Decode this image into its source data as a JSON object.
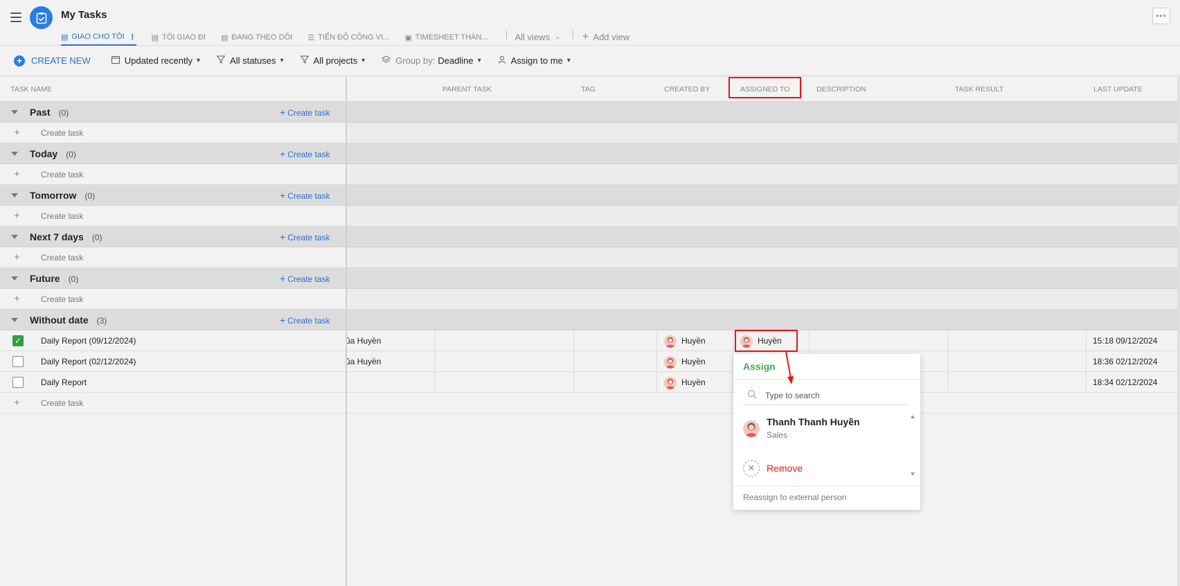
{
  "header": {
    "title": "My Tasks",
    "tabs": [
      {
        "label": "GIAO CHO TÔI",
        "active": true
      },
      {
        "label": "TÔI GIAO ĐI",
        "active": false
      },
      {
        "label": "ĐANG THEO DÕI",
        "active": false
      },
      {
        "label": "TIẾN ĐỘ CÔNG VI...",
        "active": false
      },
      {
        "label": "TIMESHEET THÀN...",
        "active": false
      }
    ],
    "all_views": "All views",
    "add_view": "Add view",
    "more": "•••"
  },
  "toolbar": {
    "create_new": "CREATE NEW",
    "sort": "Updated recently",
    "status": "All statuses",
    "projects": "All projects",
    "group_by_label": "Group by:",
    "group_by_value": "Deadline",
    "assign": "Assign to me"
  },
  "columns": {
    "task_name": "TASK NAME",
    "parent_task": "PARENT TASK",
    "tag": "TAG",
    "created_by": "CREATED BY",
    "assigned_to": "ASSIGNED TO",
    "description": "DESCRIPTION",
    "task_result": "TASK RESULT",
    "last_update": "LAST UPDATE"
  },
  "groups": [
    {
      "name": "Past",
      "count": "(0)",
      "create_label": "Create task"
    },
    {
      "name": "Today",
      "count": "(0)",
      "create_label": "Create task"
    },
    {
      "name": "Tomorrow",
      "count": "(0)",
      "create_label": "Create task"
    },
    {
      "name": "Next 7 days",
      "count": "(0)",
      "create_label": "Create task"
    },
    {
      "name": "Future",
      "count": "(0)",
      "create_label": "Create task"
    },
    {
      "name": "Without date",
      "count": "(3)",
      "create_label": "Create task"
    }
  ],
  "create_task_row": "Create task",
  "tasks": [
    {
      "name": "Daily Report (09/12/2024)",
      "checked": true,
      "project_fragment": "ủa Huyền",
      "created_by": "Huyền",
      "assigned_to": "Huyền",
      "last_update": "15:18 09/12/2024"
    },
    {
      "name": "Daily Report (02/12/2024)",
      "checked": false,
      "project_fragment": "ủa Huyền",
      "created_by": "Huyền",
      "assigned_to": "",
      "last_update": "18:36 02/12/2024"
    },
    {
      "name": "Daily Report",
      "checked": false,
      "project_fragment": "",
      "created_by": "Huyền",
      "assigned_to": "",
      "last_update": "18:34 02/12/2024"
    }
  ],
  "assign_popup": {
    "title": "Assign",
    "search_placeholder": "Type to search",
    "person_name": "Thanh Thanh Huyền",
    "person_role": "Sales",
    "remove_label": "Remove",
    "reassign_label": "Reassign to external person"
  },
  "colors": {
    "accent": "#2a6fd0",
    "assign_green": "#3bb34a",
    "remove_red": "#d21f1f",
    "highlight": "#ee1111"
  }
}
